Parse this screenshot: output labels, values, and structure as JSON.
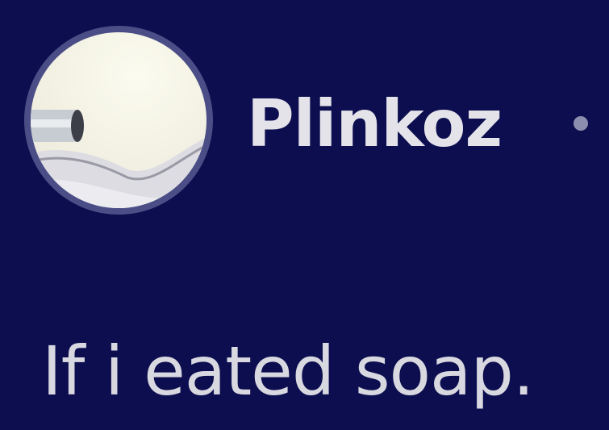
{
  "post": {
    "author": {
      "username": "Plinkoz",
      "avatar_icon": "avatar-image"
    },
    "separator_icon": "dot-separator",
    "text": "If i eated soap."
  },
  "colors": {
    "background": "#0c0e4f",
    "text": "#e4e3ea",
    "avatar_ring": "#4b4e86"
  }
}
